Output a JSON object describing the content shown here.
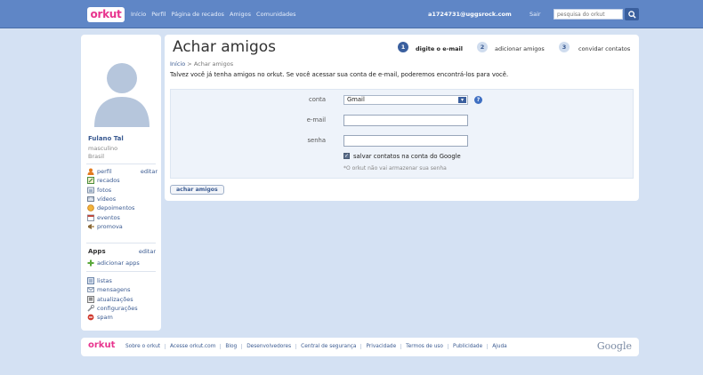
{
  "topbar": {
    "logo": "orkut",
    "nav": [
      "Início",
      "Perfil",
      "Página de recados",
      "Amigos",
      "Comunidades"
    ],
    "email": "a1724731@uggsrock.com",
    "sair": "Sair",
    "search_placeholder": "pesquisa do orkut",
    "search_icon": "magnifier-icon"
  },
  "sidebar": {
    "name": "Fulano Tal",
    "gender": "masculino",
    "country": "Brasil",
    "items": [
      {
        "label": "perfil",
        "edit": "editar",
        "icon": "profile-icon",
        "color": "#e27a1f"
      },
      {
        "label": "recados",
        "icon": "scraps-icon",
        "color": "#4a8d3b"
      },
      {
        "label": "fotos",
        "icon": "photos-icon",
        "color": "#7f8fa6"
      },
      {
        "label": "vídeos",
        "icon": "videos-icon",
        "color": "#6d7d94"
      },
      {
        "label": "depoimentos",
        "icon": "testimonials-icon",
        "color": "#e59b1d"
      },
      {
        "label": "eventos",
        "icon": "events-icon",
        "color": "#c0473b"
      },
      {
        "label": "promova",
        "icon": "promote-icon",
        "color": "#8a6a3a"
      }
    ],
    "apps_title": "Apps",
    "apps_edit": "editar",
    "add_apps": "adicionar apps",
    "tools": [
      {
        "label": "listas",
        "icon": "lists-icon",
        "color": "#6b84a8"
      },
      {
        "label": "mensagens",
        "icon": "messages-icon",
        "color": "#8798b0"
      },
      {
        "label": "atualizações",
        "icon": "updates-icon",
        "color": "#7a7a7a"
      },
      {
        "label": "configurações",
        "icon": "settings-icon",
        "color": "#8b8f96"
      },
      {
        "label": "spam",
        "icon": "spam-icon",
        "color": "#d03a2f"
      }
    ]
  },
  "main": {
    "title": "Achar amigos",
    "breadcrumb_home": "Início",
    "breadcrumb_sep": ">",
    "breadcrumb_current": "Achar amigos",
    "intro": "Talvez você já tenha amigos no orkut. Se você acessar sua conta de e-mail, poderemos encontrá-los para você.",
    "steps": [
      {
        "num": "1",
        "label": "digite o e-mail",
        "active": true
      },
      {
        "num": "2",
        "label": "adicionar amigos",
        "active": false
      },
      {
        "num": "3",
        "label": "convidar contatos",
        "active": false
      }
    ],
    "form": {
      "account_label": "conta",
      "account_value": "Gmail",
      "email_label": "e-mail",
      "email_value": "",
      "password_label": "senha",
      "password_value": "",
      "save_label": "salvar contatos na conta do Google",
      "save_checked": true,
      "note": "*O orkut não vai armazenar sua senha"
    },
    "find_button": "achar amigos"
  },
  "footer": {
    "logo": "orkut",
    "links": [
      "Sobre o orkut",
      "Acesse orkut.com",
      "Blog",
      "Desenvolvedores",
      "Central de segurança",
      "Privacidade",
      "Termos de uso",
      "Publicidade",
      "Ajuda"
    ],
    "google": "Google"
  },
  "colors": {
    "background": "#d4e1f3",
    "topbar": "#5f86c6",
    "accent": "#3a5f9e",
    "link": "#3a5a91",
    "brand_pink": "#e8348e"
  }
}
